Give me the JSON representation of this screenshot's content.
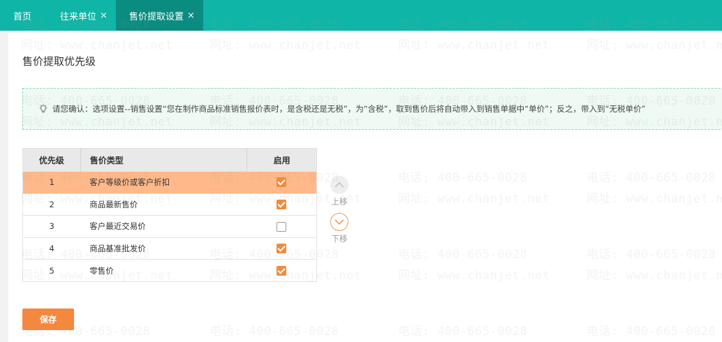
{
  "tabs": [
    {
      "label": "首页",
      "closable": false,
      "active": false
    },
    {
      "label": "往来单位",
      "closable": true,
      "active": false
    },
    {
      "label": "售价提取设置",
      "closable": true,
      "active": true
    }
  ],
  "close_glyph": "×",
  "page_title": "售价提取优先级",
  "notice": {
    "icon": "lightbulb-icon",
    "text": "请您确认：选项设置--销售设置“您在制作商品标准销售报价表时，是含税还是无税”，为“含税”，取到售价后将自动带入到销售单据中“单价”；反之，带入到“无税单价”"
  },
  "table": {
    "headers": [
      "优先级",
      "售价类型",
      "启用"
    ],
    "rows": [
      {
        "priority": "1",
        "type": "客户等级价或客户折扣",
        "enabled": true,
        "selected": true
      },
      {
        "priority": "2",
        "type": "商品最新售价",
        "enabled": true,
        "selected": false
      },
      {
        "priority": "3",
        "type": "客户最近交易价",
        "enabled": false,
        "selected": false
      },
      {
        "priority": "4",
        "type": "商品基准批发价",
        "enabled": true,
        "selected": false
      },
      {
        "priority": "5",
        "type": "零售价",
        "enabled": true,
        "selected": false
      }
    ]
  },
  "move_up_label": "上移",
  "move_down_label": "下移",
  "save_label": "保存",
  "watermark": {
    "phone": "电话: 400-665-0028",
    "site": "网址: www.chanjet.net"
  },
  "colors": {
    "tabbar": "#0fb5a6",
    "active_tab": "#0b8c80",
    "selected_row": "#ffb889",
    "checkbox": "#f08c3c",
    "save_button": "#f5883f"
  }
}
